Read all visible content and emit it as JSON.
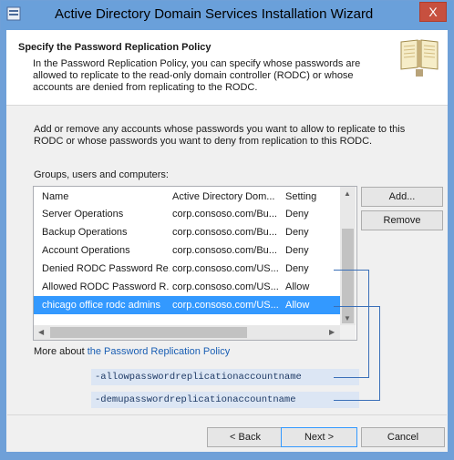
{
  "window": {
    "title": "Active Directory Domain Services Installation Wizard",
    "close_glyph": "X"
  },
  "header": {
    "title": "Specify the Password Replication Policy",
    "description": "In the Password Replication Policy, you can specify whose passwords are allowed to replicate to the read-only domain controller (RODC) or whose accounts are denied from replicating to the RODC."
  },
  "main": {
    "instructions": "Add or remove any accounts whose passwords you want to allow to replicate to this RODC or whose passwords you want to deny from replication to this RODC.",
    "groups_label": "Groups, users and computers:",
    "columns": [
      "Name",
      "Active Directory Domain Services Folder",
      "Setting"
    ],
    "columns_display": [
      "Name",
      "Active Directory Dom...",
      "Setting"
    ],
    "rows": [
      {
        "name": "Server Operations",
        "folder": "corp.consoso.com/Bu...",
        "setting": "Deny"
      },
      {
        "name": "Backup Operations",
        "folder": "corp.consoso.com/Bu...",
        "setting": "Deny"
      },
      {
        "name": "Account Operations",
        "folder": "corp.consoso.com/Bu...",
        "setting": "Deny"
      },
      {
        "name": "Denied RODC Password Re...",
        "folder": "corp.consoso.com/US...",
        "setting": "Deny"
      },
      {
        "name": "Allowed RODC Password R...",
        "folder": "corp.consoso.com/US...",
        "setting": "Allow"
      },
      {
        "name": "chicago office rodc admins",
        "folder": "corp.consoso.com/US...",
        "setting": "Allow"
      }
    ],
    "selected_row": 5,
    "add_button": "Add...",
    "remove_button": "Remove",
    "more_about_prefix": "More about ",
    "more_about_link": "the Password Replication Policy"
  },
  "annotations": {
    "allow_param": "-allowpasswordreplicationaccountname",
    "deny_param": "-demupasswordreplicationaccountname"
  },
  "footer": {
    "back_button": "< Back",
    "next_button": "Next >",
    "cancel_button": "Cancel"
  },
  "colors": {
    "title_bar": "#6aa0da",
    "selection": "#3399ff",
    "callout": "#3a6fb8",
    "close_button": "#c7503f",
    "link": "#1a5fb4"
  },
  "icons": [
    "app-icon",
    "close-icon",
    "book-icon",
    "scroll-up-arrow-icon",
    "scroll-down-arrow-icon",
    "scroll-left-arrow-icon",
    "scroll-right-arrow-icon"
  ]
}
